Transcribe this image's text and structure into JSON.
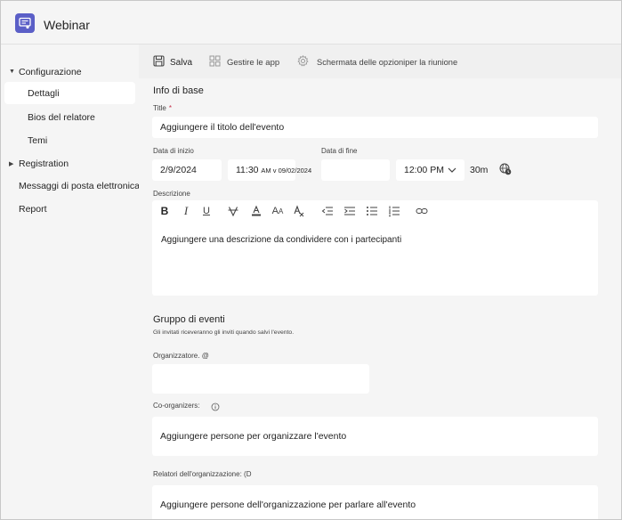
{
  "app": {
    "title": "Webinar"
  },
  "sidebar": {
    "groups": [
      {
        "label": "Configurazione",
        "expanded": true
      },
      {
        "label": "Registration",
        "expanded": false
      }
    ],
    "items": [
      {
        "label": "Dettagli",
        "active": true
      },
      {
        "label": "Bios del relatore",
        "active": false
      },
      {
        "label": "Temi",
        "active": false
      }
    ],
    "plain_items": [
      {
        "label": "Messaggi di posta elettronica"
      },
      {
        "label": "Report"
      }
    ]
  },
  "toolbar": {
    "save_label": "Salva",
    "apps_label": "Gestire le app",
    "options_label": "Schermata delle opzioniper la riunione"
  },
  "form": {
    "basic_info_title": "Info di base",
    "title_label": "Title",
    "title_required_mark": "*",
    "title_placeholder": "Aggiungere il titolo dell'evento",
    "start_date_label": "Data di inizio",
    "start_date_value": "2/9/2024",
    "start_time_value": "11:30",
    "start_time_suffix": "AM v 09/02/2024",
    "end_date_label": "Data di fine",
    "end_date_value": "",
    "end_time_value": "12:00 PM",
    "duration": "30m",
    "description_label": "Descrizione",
    "description_placeholder": "Aggiungere una descrizione da condividere con i partecipanti",
    "event_group_title": "Gruppo di eventi",
    "event_group_hint": "Gli invitati riceveranno gli inviti quando salvi l'evento.",
    "organizer_label": "Organizzatore. @",
    "coorganizers_label": "Co-organizers:",
    "coorganizers_placeholder": "Aggiungere persone per organizzare l'evento",
    "speakers_label": "Relatori dell'organizzazione: (D",
    "speakers_placeholder": "Aggiungere persone dell'organizzazione per parlare all'evento"
  },
  "colors": {
    "brand": "#5b5fc7",
    "required": "#c4314b",
    "panel": "#f5f5f5",
    "field": "#ffffff"
  },
  "icons": {
    "app": "webinar-icon",
    "save": "save-icon",
    "apps": "apps-grid-icon",
    "options": "gear-icon",
    "timezone": "globe-clock-icon",
    "info": "info-icon"
  }
}
